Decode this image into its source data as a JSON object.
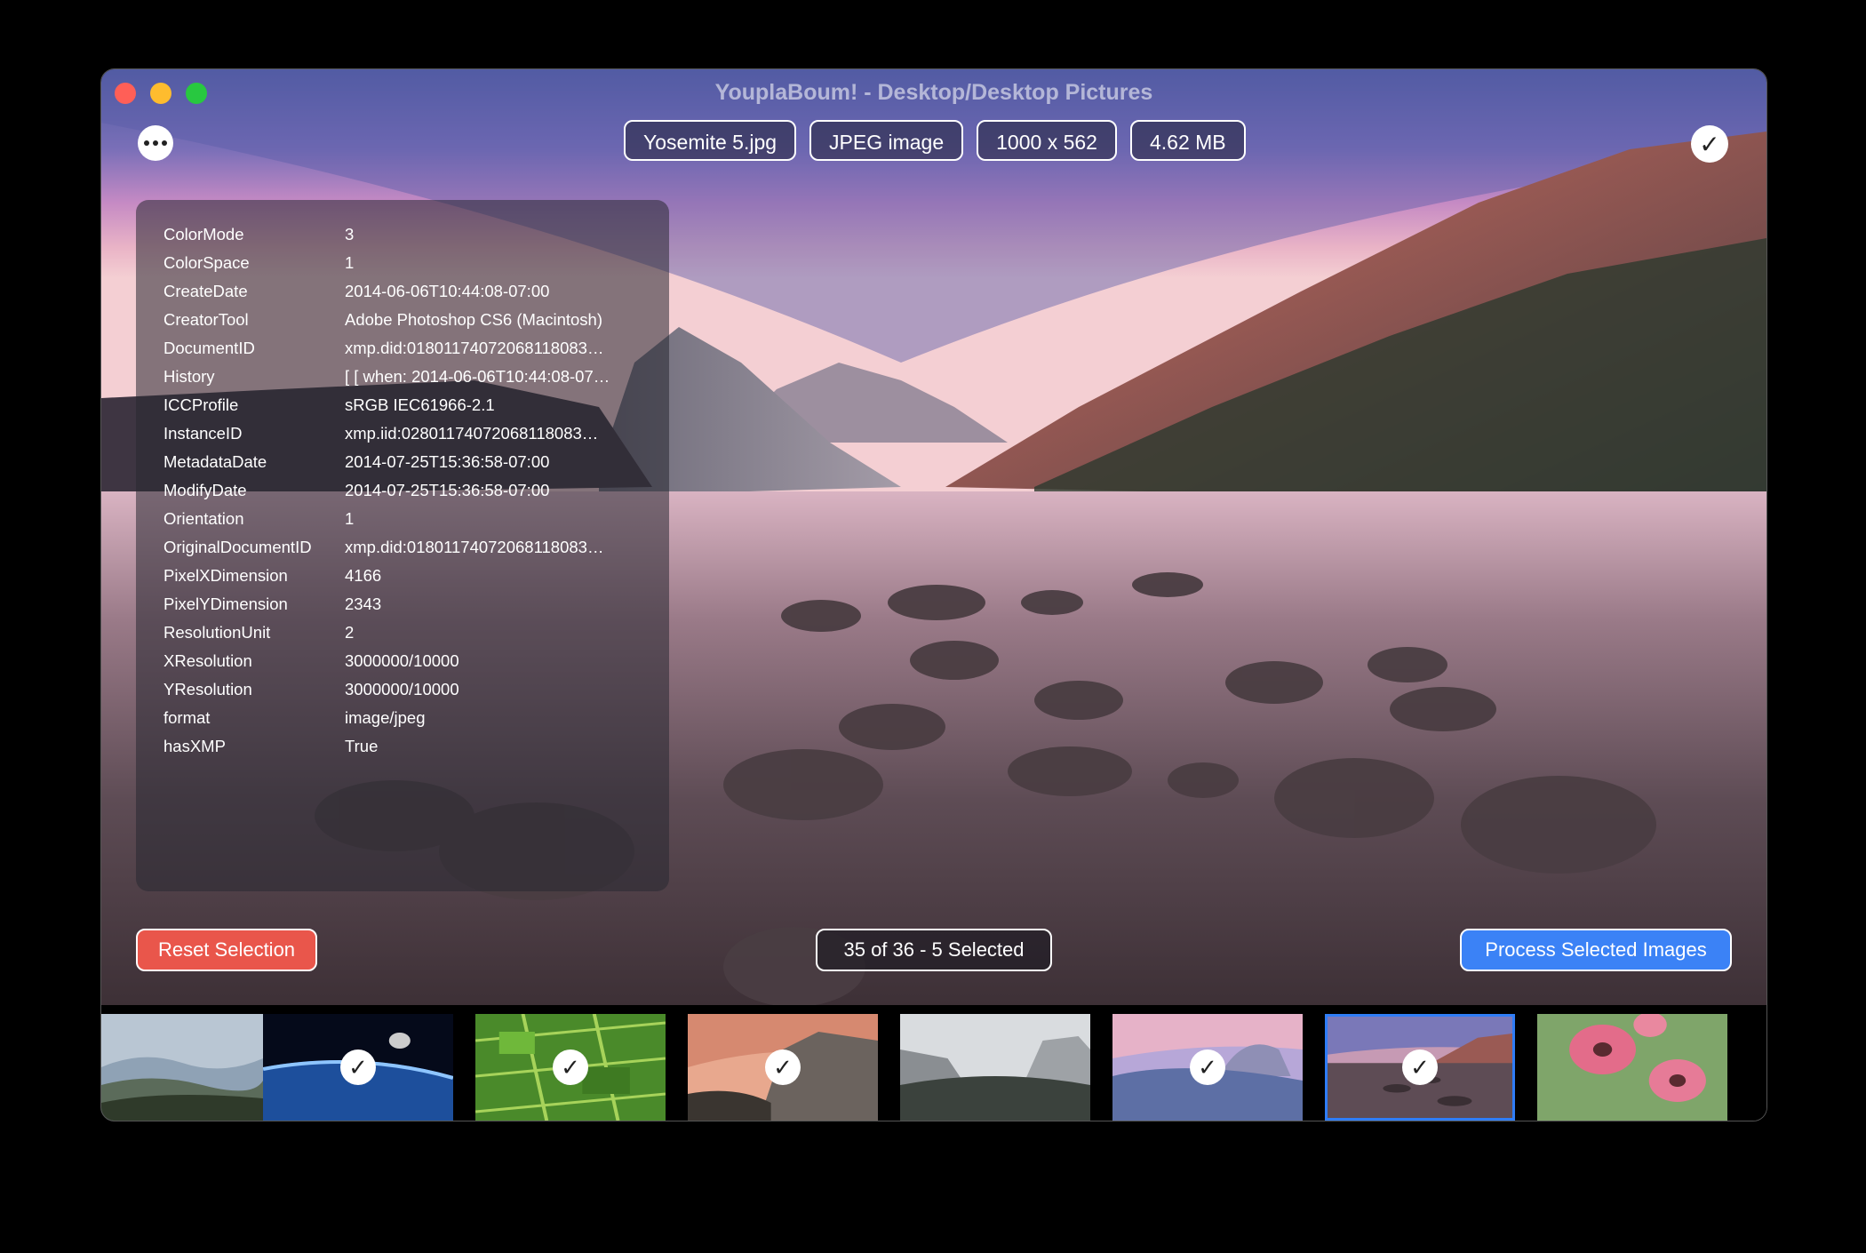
{
  "window": {
    "title": "YouplaBoum! - Desktop/Desktop Pictures"
  },
  "toolbar": {
    "more_icon": "ellipsis-icon",
    "select_icon": "checkmark-icon",
    "file_name": "Yosemite 5.jpg",
    "file_type": "JPEG image",
    "dimensions": "1000 x 562",
    "file_size": "4.62 MB"
  },
  "metadata": [
    {
      "key": "ColorMode",
      "value": "3"
    },
    {
      "key": "ColorSpace",
      "value": "1"
    },
    {
      "key": "CreateDate",
      "value": "2014-06-06T10:44:08-07:00"
    },
    {
      "key": "CreatorTool",
      "value": "Adobe Photoshop CS6 (Macintosh)"
    },
    {
      "key": "DocumentID",
      "value": "xmp.did:01801174072068118083…"
    },
    {
      "key": "History",
      "value": "[ [ when: 2014-06-06T10:44:08-07…"
    },
    {
      "key": "ICCProfile",
      "value": "sRGB IEC61966-2.1"
    },
    {
      "key": "InstanceID",
      "value": "xmp.iid:02801174072068118083…"
    },
    {
      "key": "MetadataDate",
      "value": "2014-07-25T15:36:58-07:00"
    },
    {
      "key": "ModifyDate",
      "value": "2014-07-25T15:36:58-07:00"
    },
    {
      "key": "Orientation",
      "value": "1"
    },
    {
      "key": "OriginalDocumentID",
      "value": "xmp.did:01801174072068118083…"
    },
    {
      "key": "PixelXDimension",
      "value": "4166"
    },
    {
      "key": "PixelYDimension",
      "value": "2343"
    },
    {
      "key": "ResolutionUnit",
      "value": "2"
    },
    {
      "key": "XResolution",
      "value": "3000000/10000"
    },
    {
      "key": "YResolution",
      "value": "3000000/10000"
    },
    {
      "key": "format",
      "value": "image/jpeg"
    },
    {
      "key": "hasXMP",
      "value": "True"
    }
  ],
  "actions": {
    "reset_label": "Reset Selection",
    "count_label": "35 of 36 - 5 Selected",
    "process_label": "Process Selected Images"
  },
  "thumbnails": [
    {
      "scene": "misty-hills",
      "selected": false,
      "current": false
    },
    {
      "scene": "earth-space",
      "selected": true,
      "current": false
    },
    {
      "scene": "green-fields",
      "selected": true,
      "current": false
    },
    {
      "scene": "el-capitan-sunset",
      "selected": true,
      "current": false
    },
    {
      "scene": "yosemite-valley-bw",
      "selected": false,
      "current": false
    },
    {
      "scene": "half-dome-dusk",
      "selected": true,
      "current": false
    },
    {
      "scene": "lake-rocks",
      "selected": true,
      "current": true
    },
    {
      "scene": "pink-poppies",
      "selected": false,
      "current": false
    }
  ],
  "colors": {
    "reset": "#e9564b",
    "process": "#3b82f6",
    "current_border": "#2f7df6"
  }
}
